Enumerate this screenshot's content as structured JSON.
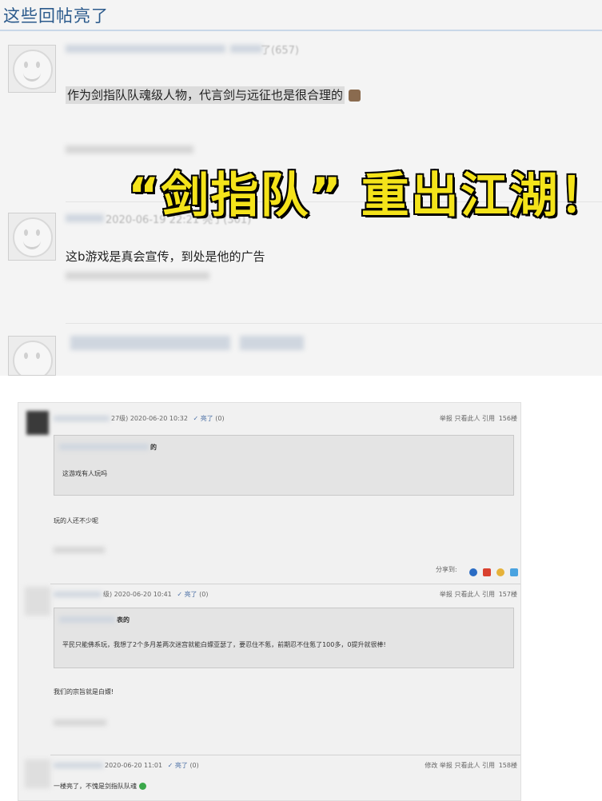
{
  "top": {
    "section_title": "这些回帖亮了",
    "post1": {
      "meta": "了(657)",
      "text": "作为剑指队队魂级人物，代言剑与远征也是很合理的"
    },
    "post2": {
      "meta": "2020-06-19 22:21 亮了(301)",
      "text": "这b游戏是真会宣传，到处是他的广告"
    }
  },
  "overlay_title": "“剑指队” 重出江湖！",
  "bottom": {
    "post156": {
      "meta": "27级) 2020-06-20 10:32",
      "like_label": "亮了",
      "like_count": "(0)",
      "actions": "举报  只看此人  引用",
      "floor": "156楼",
      "quote_author_suffix": "的",
      "quote_text": "这游戏有人玩吗",
      "reply": "玩的人还不少呢",
      "share_label": "分享到:"
    },
    "post157": {
      "meta": "级) 2020-06-20 10:41",
      "like_label": "亮了",
      "like_count": "(0)",
      "actions": "举报  只看此人  引用",
      "floor": "157楼",
      "quote_author_suffix": "表的",
      "quote_text": "平民只能佛系玩，我想了2个多月差两次迷宫就能白嫖亚瑟了，要忍住不氪，前期忍不住氪了100多，0提升就很棒!",
      "reply": "我们的宗旨就是白嫖!"
    },
    "post158": {
      "meta": "2020-06-20 11:01",
      "like_label": "亮了",
      "like_count": "(0)",
      "actions": "修改  举报  只看此人  引用",
      "floor": "158楼",
      "reply": "一楼亮了，不愧是剑指队队魂"
    }
  },
  "colors": {
    "title_blue": "#2b5a8c",
    "overlay_yellow": "#f4e31a",
    "overlay_stroke": "#000000"
  }
}
